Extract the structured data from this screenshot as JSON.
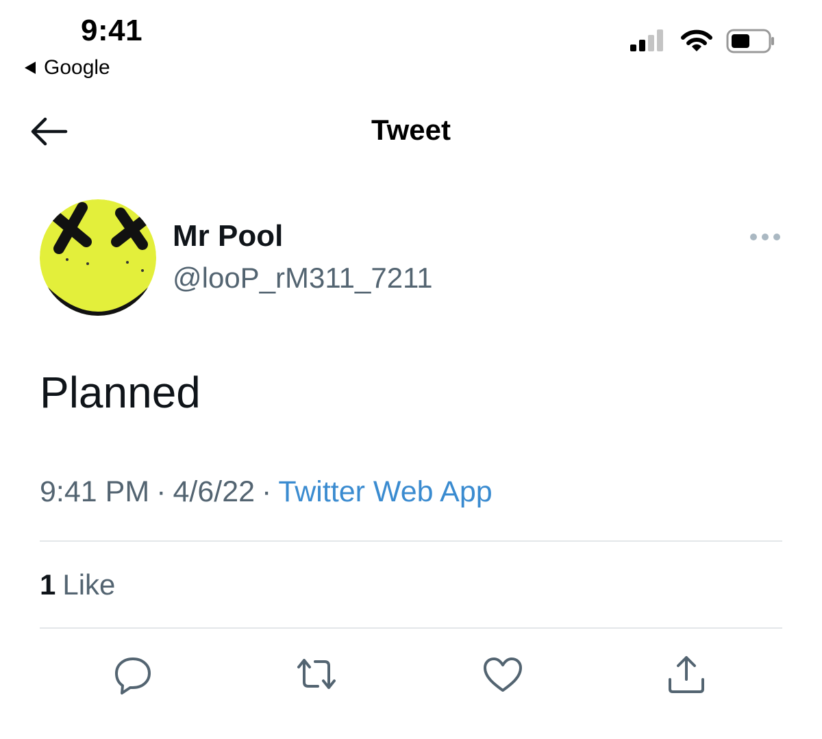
{
  "status_bar": {
    "time": "9:41",
    "back_app": "Google",
    "icons": [
      "cellular-signal-icon",
      "wifi-icon",
      "battery-icon"
    ]
  },
  "header": {
    "title": "Tweet",
    "back_icon": "back-arrow-icon"
  },
  "tweet": {
    "author": {
      "display_name": "Mr Pool",
      "handle": "@looP_rM311_7211"
    },
    "text": "Planned",
    "time": "9:41 PM",
    "date": "4/6/22",
    "separator": "·",
    "source": "Twitter Web App",
    "likes": {
      "count": "1",
      "label": "Like"
    }
  },
  "actions": [
    {
      "name": "reply",
      "icon": "reply-icon"
    },
    {
      "name": "retweet",
      "icon": "retweet-icon"
    },
    {
      "name": "like",
      "icon": "heart-icon"
    },
    {
      "name": "share",
      "icon": "share-icon"
    }
  ],
  "colors": {
    "text_primary": "#0f1419",
    "text_secondary": "#536471",
    "link": "#3a8bd0",
    "divider": "#e3e6e9",
    "avatar_yellow": "#e3ef3b"
  }
}
